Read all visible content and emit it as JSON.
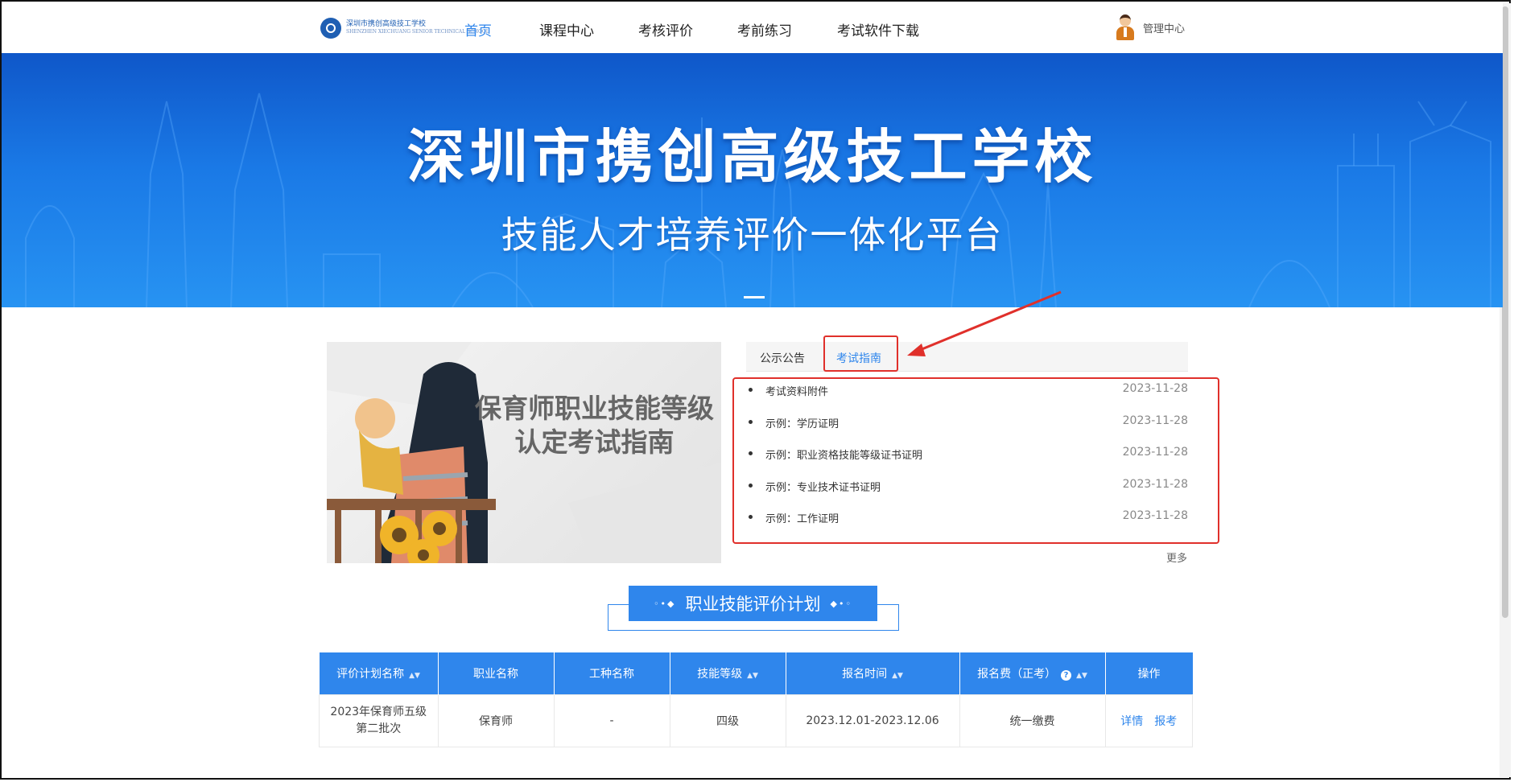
{
  "header": {
    "logo_text": "深圳市携创高级技工学校",
    "logo_subtext": "SHENZHEN XIECHUANG SENIOR TECHNICAL SCHOOL",
    "nav": [
      "首页",
      "课程中心",
      "考核评价",
      "考前练习",
      "考试软件下载"
    ],
    "active_nav": "首页",
    "user_label": "管理中心"
  },
  "banner": {
    "title": "深圳市携创高级技工学校",
    "subtitle": "技能人才培养评价一体化平台"
  },
  "feature": {
    "text_line1": "保育师职业技能等级",
    "text_line2": "认定考试指南"
  },
  "tabs": [
    {
      "label": "公示公告",
      "active": false
    },
    {
      "label": "考试指南",
      "active": true
    }
  ],
  "list": [
    {
      "title": "考试资料附件",
      "date": "2023-11-28"
    },
    {
      "title": "示例：学历证明",
      "date": "2023-11-28"
    },
    {
      "title": "示例：职业资格技能等级证书证明",
      "date": "2023-11-28"
    },
    {
      "title": "示例：专业技术证书证明",
      "date": "2023-11-28"
    },
    {
      "title": "示例：工作证明",
      "date": "2023-11-28"
    }
  ],
  "more_label": "更多",
  "section_title": "职业技能评价计划",
  "table": {
    "headers": [
      "评价计划名称",
      "职业名称",
      "工种名称",
      "技能等级",
      "报名时间",
      "报名费（正考）",
      "操作"
    ],
    "rows": [
      {
        "plan": "2023年保育师五级第二批次",
        "occupation": "保育师",
        "trade": "-",
        "level": "四级",
        "time": "2023.12.01-2023.12.06",
        "fee": "统一缴费",
        "action_detail": "详情",
        "action_register": "报考"
      }
    ]
  },
  "colors": {
    "accent": "#2f86ec",
    "banner": "#1a79e6",
    "highlight_box": "#e0302b"
  }
}
